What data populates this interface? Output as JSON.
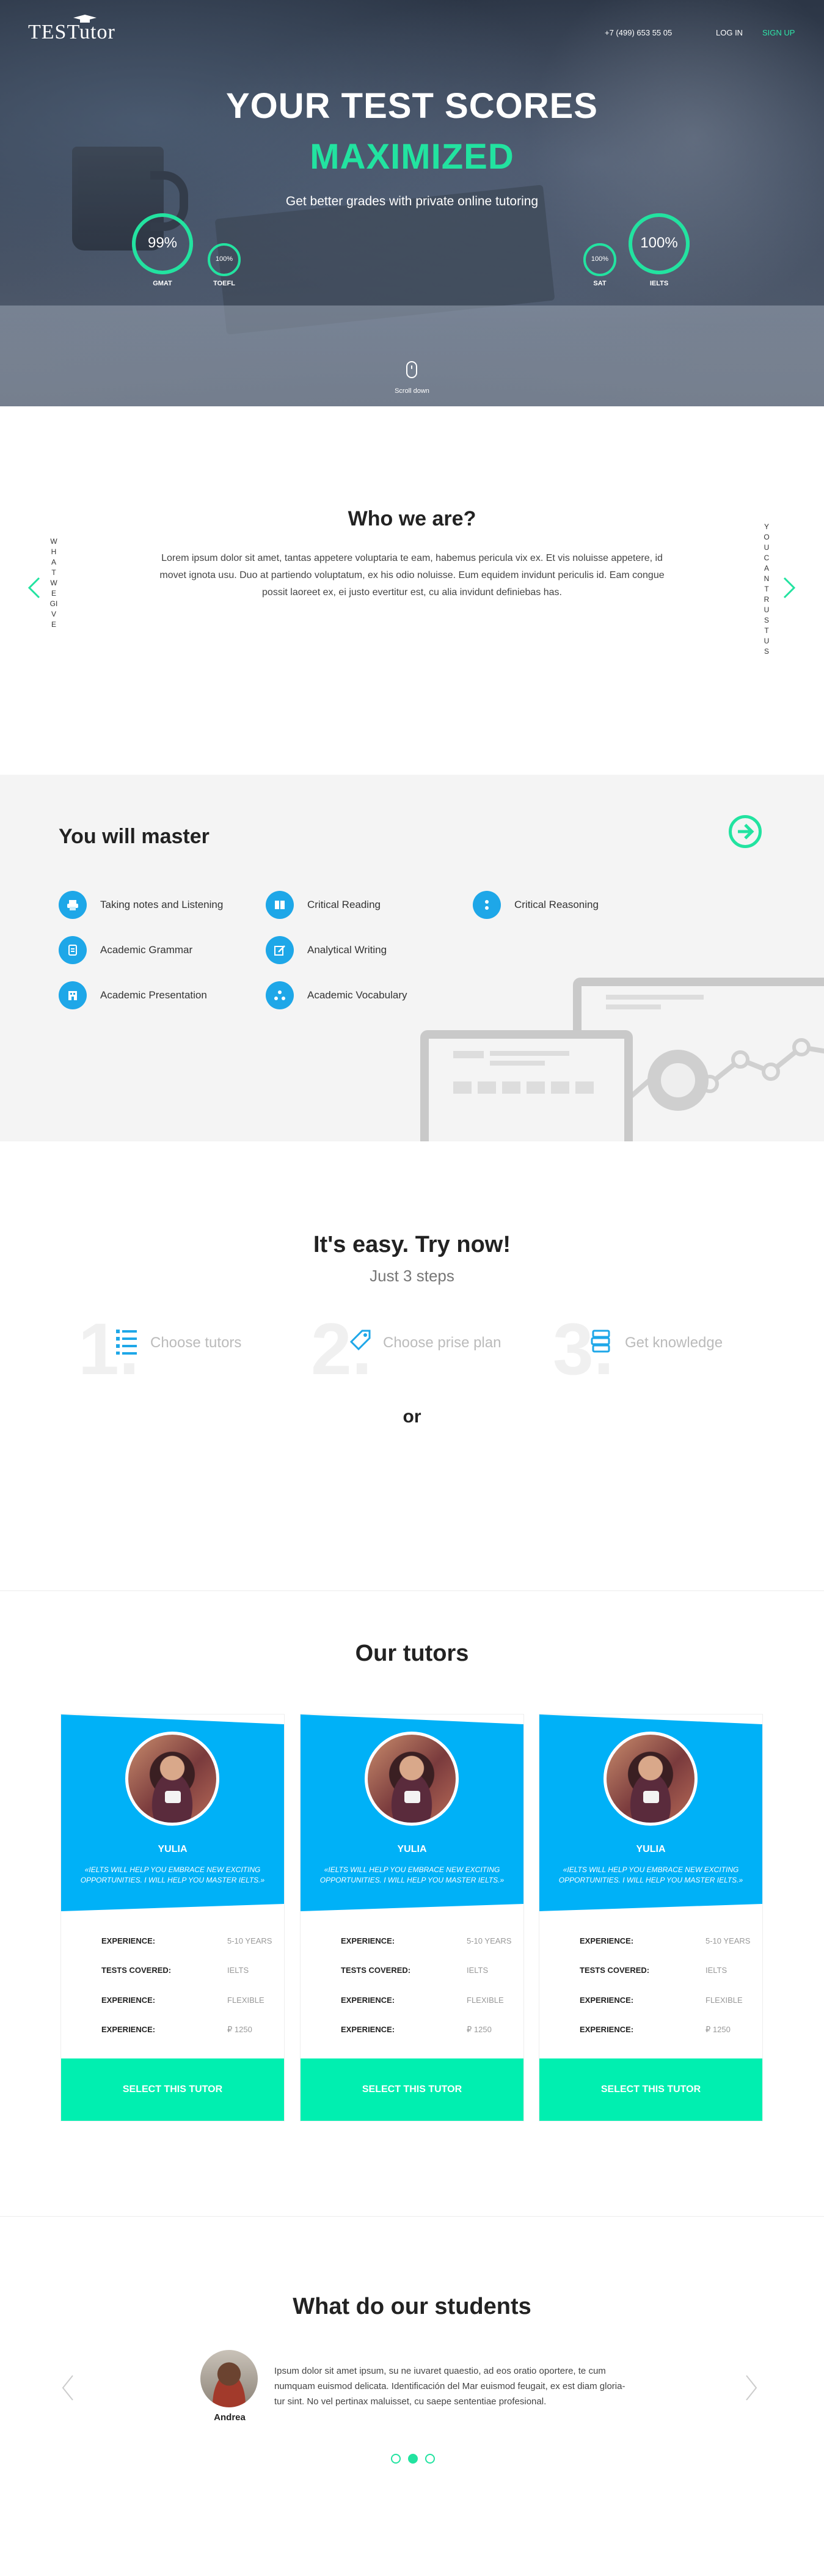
{
  "header": {
    "logo": "TESTutor",
    "phone": "+7 (499) 653 55 05",
    "login": "LOG IN",
    "signup": "SIGN UP"
  },
  "hero": {
    "title_line1": "YOUR TEST SCORES",
    "title_line2": "MAXIMIZED",
    "subtitle": "Get better grades with private online tutoring",
    "scroll_label": "Scroll down",
    "gauges": [
      {
        "percent_label": "99%",
        "label": "GMAT",
        "progress": 0.99
      },
      {
        "percent_label": "100%",
        "label": "TOEFL",
        "progress": 1.0
      },
      {
        "percent_label": "100%",
        "label": "SAT",
        "progress": 1.0
      },
      {
        "percent_label": "100%",
        "label": "IELTS",
        "progress": 1.0
      }
    ]
  },
  "who": {
    "title": "Who we are?",
    "text": "Lorem ipsum dolor sit amet, tantas appetere voluptaria te eam, habemus pericula vix ex. Et vis noluisse appetere, id movet ignota usu. Duo at partiendo voluptatum, ex his odio noluisse. Eum equidem invidunt periculis id. Eam congue possit laoreet ex, ei justo evertitur est, cu alia invidunt definiebas has.",
    "side_left": "WHAT WE GIVE",
    "side_right": "YOU CAN TRUST US"
  },
  "master": {
    "title": "You will master",
    "skills": [
      "Taking notes and Listening",
      "Critical Reading",
      "Critical Reasoning",
      "Academic Grammar",
      "Analytical Writing",
      "Academic Presentation",
      "Academic Vocabulary"
    ]
  },
  "easy": {
    "title": "It's easy. Try now!",
    "subtitle": "Just 3 steps",
    "steps": [
      {
        "num": "1.",
        "label": "Choose tutors"
      },
      {
        "num": "2.",
        "label": "Choose prise plan"
      },
      {
        "num": "3.",
        "label": "Get knowledge"
      }
    ],
    "or": "or"
  },
  "tutors": {
    "title": "Our tutors",
    "cards": [
      {
        "name": "YULIA",
        "quote": "«IELTS WILL HELP YOU EMBRACE NEW EXCITING OPPORTUNITIES. I WILL HELP YOU MASTER IELTS.»",
        "rows": [
          {
            "k": "EXPERIENCE:",
            "v": "5-10 YEARS"
          },
          {
            "k": "TESTS COVERED:",
            "v": "IELTS"
          },
          {
            "k": "EXPERIENCE:",
            "v": "FLEXIBLE"
          },
          {
            "k": "EXPERIENCE:",
            "v": "₽ 1250"
          }
        ],
        "button": "SELECT THIS TUTOR"
      },
      {
        "name": "YULIA",
        "quote": "«IELTS WILL HELP YOU EMBRACE NEW EXCITING OPPORTUNITIES. I WILL HELP YOU MASTER IELTS.»",
        "rows": [
          {
            "k": "EXPERIENCE:",
            "v": "5-10 YEARS"
          },
          {
            "k": "TESTS COVERED:",
            "v": "IELTS"
          },
          {
            "k": "EXPERIENCE:",
            "v": "FLEXIBLE"
          },
          {
            "k": "EXPERIENCE:",
            "v": "₽ 1250"
          }
        ],
        "button": "SELECT THIS TUTOR"
      },
      {
        "name": "YULIA",
        "quote": "«IELTS WILL HELP YOU EMBRACE NEW EXCITING OPPORTUNITIES. I WILL HELP YOU MASTER IELTS.»",
        "rows": [
          {
            "k": "EXPERIENCE:",
            "v": "5-10 YEARS"
          },
          {
            "k": "TESTS COVERED:",
            "v": "IELTS"
          },
          {
            "k": "EXPERIENCE:",
            "v": "FLEXIBLE"
          },
          {
            "k": "EXPERIENCE:",
            "v": "₽ 1250"
          }
        ],
        "button": "SELECT THIS TUTOR"
      }
    ]
  },
  "students": {
    "title": "What do our students",
    "name": "Andrea",
    "text": "Ipsum dolor sit amet ipsum, su ne iuvaret quaestio, ad eos oratio oportere, te cum numquam euismod delicata. Identificación del Mar euismod feugait, ex est diam gloria-tur sint. No vel pertinax maluisset, cu saepe sententiae profesional.",
    "active_slide": 2,
    "slides": 3
  },
  "colors": {
    "accent": "#22e3a0",
    "blue": "#00b1f7",
    "icon_blue": "#1ea7e8",
    "button": "#00efb0"
  }
}
